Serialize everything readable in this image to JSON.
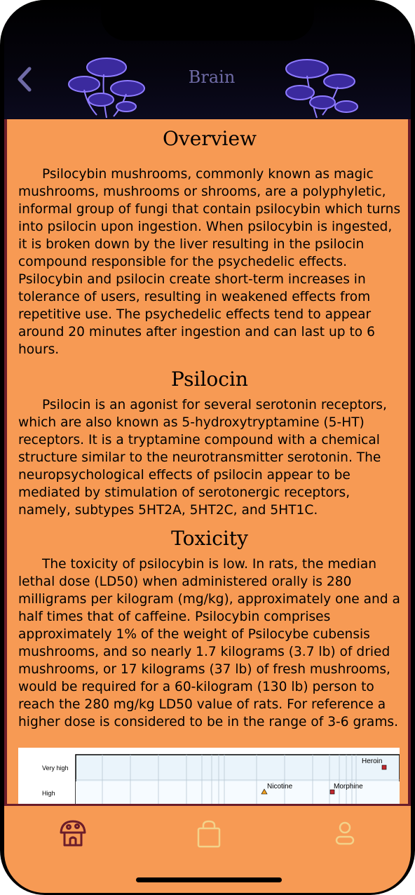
{
  "header": {
    "title": "Brain",
    "back_icon": "chevron-left-icon",
    "decoration_icon": "mushroom-icon"
  },
  "sections": {
    "overview": {
      "heading": "Overview",
      "body": "Psilocybin mushrooms, commonly known as magic mushrooms, mushrooms or shrooms, are a polyphyletic, informal group of fungi that contain psilocybin which turns into psilocin upon ingestion. When psilocybin is ingested, it is broken down by the liver resulting in the psilocin compound responsible for the psychedelic effects. Psilocybin and psilocin create short-term increases in tolerance of users, resulting in weakened effects from repetitive use. The psychedelic effects tend to appear around 20 minutes after ingestion and can last up to 6 hours."
    },
    "psilocin": {
      "heading": "Psilocin",
      "body": "Psilocin is an agonist for several serotonin receptors, which are also known as 5-hydroxytryptamine (5-HT) receptors. It is a tryptamine compound with a chemical structure similar to the neurotransmitter serotonin. The neuropsychological effects of psilocin appear to be mediated by stimulation of serotonergic receptors, namely, subtypes 5HT2A, 5HT2C, and 5HT1C."
    },
    "toxicity": {
      "heading": "Toxicity",
      "body": "The toxicity of psilocybin is low. In rats, the median lethal dose (LD50) when administered orally is 280 milligrams per kilogram (mg/kg), approximately one and a half times that of caffeine. Psilocybin comprises approximately 1% of the weight of Psilocybe cubensis mushrooms, and so nearly 1.7 kilograms (3.7 lb) of dried mushrooms, or 17 kilograms (37 lb) of fresh mushrooms, would be required for a 60-kilogram (130 lb) person to reach the 280 mg/kg LD50 value of rats. For reference a higher dose is considered to be in the range of 3-6 grams."
    }
  },
  "chart_image": {
    "y_labels": [
      "Very high",
      "High"
    ],
    "points": [
      {
        "label": "Heroin",
        "level": "Very high",
        "marker": "square"
      },
      {
        "label": "Nicotine",
        "level": "High",
        "marker": "triangle"
      },
      {
        "label": "Morphine",
        "level": "High",
        "marker": "square"
      }
    ]
  },
  "tabbar": {
    "tabs": [
      {
        "icon": "mushroom-house-icon",
        "active": true
      },
      {
        "icon": "shopping-bag-icon",
        "active": false
      },
      {
        "icon": "profile-icon",
        "active": false
      }
    ]
  },
  "colors": {
    "page_bg": "#f79a54",
    "frame": "#6b1d2a",
    "title": "#6f6ba6",
    "active_tab": "#6b1d2a",
    "inactive_tab": "#f3d28a"
  }
}
